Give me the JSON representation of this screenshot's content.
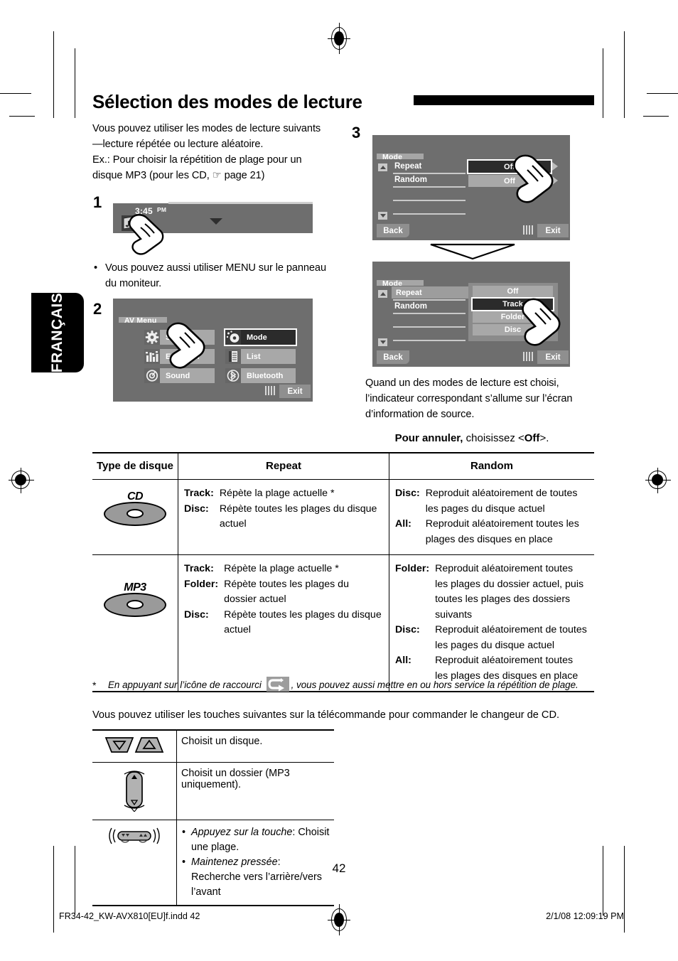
{
  "language_tab": "FRANÇAIS",
  "heading": "Sélection des modes de lecture",
  "intro": {
    "line1": "Vous pouvez utiliser les modes de lecture suivants—lecture répétée ou lecture aléatoire.",
    "line2": "Ex.: Pour choisir la répétition de plage pour un disque MP3 (pour les CD, ☞ page 21)"
  },
  "steps": {
    "one": "1",
    "two": "2",
    "three": "3",
    "note": "Vous pouvez aussi utiliser MENU sur le panneau du moniteur."
  },
  "screen_step1": {
    "clock": "3:45",
    "meridiem": "PM",
    "source_icon": "disc-music-icon",
    "dropdown_icon": "chevron-down-icon"
  },
  "screen_step2": {
    "title": "AV Menu",
    "items": [
      {
        "label": "Setup",
        "icon": "gear-icon",
        "selected": false
      },
      {
        "label": "Mode",
        "icon": "mode-dial-icon",
        "selected": true
      },
      {
        "label": "Equalizer",
        "icon": "equalizer-icon",
        "selected": false
      },
      {
        "label": "List",
        "icon": "list-icon",
        "selected": false
      },
      {
        "label": "Sound",
        "icon": "sound-icon",
        "selected": false
      },
      {
        "label": "Bluetooth",
        "icon": "bluetooth-icon",
        "selected": false
      }
    ],
    "exit": "Exit"
  },
  "screen_step3a": {
    "title": "Mode",
    "rows": [
      {
        "label": "Repeat",
        "value": "Off",
        "selected": true
      },
      {
        "label": "Random",
        "value": "Off",
        "selected": false
      }
    ],
    "back": "Back",
    "exit": "Exit"
  },
  "screen_step3b": {
    "title": "Mode",
    "rows": [
      {
        "label": "Repeat",
        "selected": true
      },
      {
        "label": "Random",
        "selected": false
      }
    ],
    "options": [
      {
        "label": "Off",
        "selected": false
      },
      {
        "label": "Track",
        "selected": true
      },
      {
        "label": "Folder",
        "selected": false
      },
      {
        "label": "Disc",
        "selected": false
      }
    ],
    "back": "Back",
    "exit": "Exit"
  },
  "after_step3": "Quand un des modes de lecture est choisi, l’indicateur correspondant s’allume sur l’écran d’information de source.",
  "cancel_note": {
    "bold": "Pour annuler,",
    "rest": " choisissez <",
    "value": "Off",
    "tail": ">."
  },
  "table": {
    "headers": [
      "Type de disque",
      "Repeat",
      "Random"
    ],
    "rows": [
      {
        "disc": "CD",
        "repeat": [
          {
            "key": "Track:",
            "val": "Répète la plage actuelle *"
          },
          {
            "key": "Disc:",
            "val": "Répète toutes les plages du disque actuel"
          }
        ],
        "random": [
          {
            "key": "Disc:",
            "val": "Reproduit aléatoirement de toutes les pages du disque actuel"
          },
          {
            "key": "All:",
            "val": "Reproduit aléatoirement toutes les plages des disques en place"
          }
        ]
      },
      {
        "disc": "MP3",
        "repeat": [
          {
            "key": "Track:",
            "val": "Répète la plage actuelle *"
          },
          {
            "key": "Folder:",
            "val": "Répète toutes les plages du dossier actuel"
          },
          {
            "key": "Disc:",
            "val": "Répète toutes les plages du disque actuel"
          }
        ],
        "random": [
          {
            "key": "Folder:",
            "val": "Reproduit aléatoirement toutes les plages du dossier actuel, puis toutes les plages des dossiers suivants"
          },
          {
            "key": "Disc:",
            "val": "Reproduit aléatoirement de toutes les pages du disque actuel"
          },
          {
            "key": "All:",
            "val": "Reproduit aléatoirement toutes les plages des disques en place"
          }
        ]
      }
    ]
  },
  "footnote": {
    "star": "*",
    "pre": "En appuyant sur l’icône de raccourci",
    "icon": "repeat-shortcut-icon",
    "post": ", vous pouvez aussi mettre en ou hors service la répétition de plage."
  },
  "remote_intro": "Vous pouvez utiliser les touches suivantes sur la télécommande pour commander le changeur de CD.",
  "remote_table": [
    {
      "icon": "disc-down-up-buttons-icon",
      "text": "Choisit un disque."
    },
    {
      "icon": "folder-rocker-button-icon",
      "text": "Choisit un dossier (MP3 uniquement)."
    },
    {
      "icon": "track-search-buttons-icon",
      "bullets": [
        {
          "em": "Appuyez sur la touche",
          "rest": ": Choisit une plage."
        },
        {
          "em": "Maintenez pressée",
          "rest": ": Recherche vers l’arrière/vers l’avant"
        }
      ]
    }
  ],
  "page_number": "42",
  "footer": {
    "left": "FR34-42_KW-AVX810[EU]f.indd   42",
    "right": "2/1/08   12:09:19 PM"
  },
  "colors": {
    "screen_bg": "#6e6e6e",
    "button_bg": "#a8a8a8",
    "selected_bg": "#2b2b2b",
    "title_bar": "#a6a6a6"
  }
}
